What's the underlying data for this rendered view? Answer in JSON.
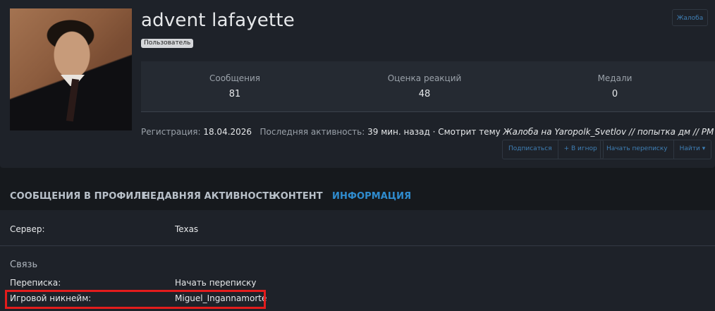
{
  "profile": {
    "username": "advent lafayette",
    "role": "Пользователь",
    "report_label": "Жалоба"
  },
  "stats": [
    {
      "label": "Сообщения",
      "value": "81"
    },
    {
      "label": "Оценка реакций",
      "value": "48"
    },
    {
      "label": "Медали",
      "value": "0"
    }
  ],
  "activity": {
    "reg_label": "Регистрация:",
    "reg_date": "18.04.2026",
    "last_label": "Последняя активность:",
    "last_value": "39 мин. назад",
    "watching": "· Смотрит тему",
    "thread": "Жалоба на Yaropolk_Svetlov // попытка дм // PM"
  },
  "actions": {
    "subscribe": "Подписаться",
    "ignore": "+ В игнор",
    "start_conv": "Начать переписку",
    "find": "Найти ▾"
  },
  "tabs": [
    "СООБЩЕНИЯ В ПРОФИЛЕ",
    "НЕДАВНЯЯ АКТИВНОСТЬ",
    "КОНТЕНТ",
    "ИНФОРМАЦИЯ"
  ],
  "info": {
    "server_label": "Сервер:",
    "server_value": "Texas",
    "contact_title": "Связь",
    "conv_label": "Переписка:",
    "conv_value": "Начать переписку",
    "nick_label": "Игровой никнейм:",
    "nick_value": "Miguel_Ingannamorte"
  },
  "colors": {
    "accent": "#2f8ccf",
    "highlight": "#e31c1c",
    "background": "#16191d",
    "card": "#1e2229"
  }
}
